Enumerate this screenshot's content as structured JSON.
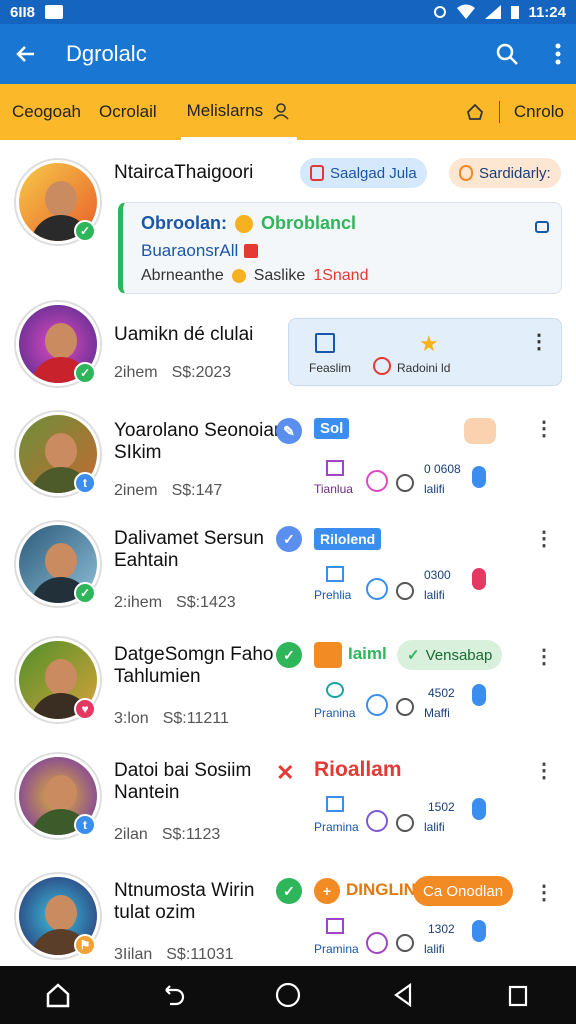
{
  "status_bar": {
    "left_text": "6II8",
    "time": "11:24"
  },
  "app_bar": {
    "title": "Dgrolalc"
  },
  "tabs": {
    "items": [
      {
        "label": "Ceogoah"
      },
      {
        "label": "Ocrolail"
      },
      {
        "label": "Melislarns"
      }
    ],
    "right_label": "Cnrolo"
  },
  "rows": [
    {
      "name": "NtaircaThaigoori",
      "pills": [
        {
          "label": "Saalgad Jula"
        },
        {
          "label": "Sardidarly:"
        }
      ],
      "card": {
        "line1_a": "Obroolan:",
        "line1_b": "Obroblancl",
        "line2": "BuaraonsrAll",
        "line3_a": "Abrneanthe",
        "line3_b": "Saslike",
        "line3_c": "1Snand"
      }
    },
    {
      "name": "Uamikn dé clulai",
      "meta_a": "2ihem",
      "meta_b": "S$:2023",
      "card_labels": {
        "a": "Feaslim",
        "b": "Radoini ld"
      }
    },
    {
      "name": "Yoarolano Seonoian",
      "name2": "SIkim",
      "meta_a": "2inem",
      "meta_b": "S$:147",
      "tag": "Sol",
      "labels": {
        "a": "Tianlua",
        "b": "0 0608",
        "c": "lalifi"
      }
    },
    {
      "name": "Dalivamet Sersun",
      "name2": "Eahtain",
      "meta_a": "2:ihem",
      "meta_b": "S$:1423",
      "tag": "Rilolend",
      "labels": {
        "a": "Prehlia",
        "b": "0300",
        "c": "lalifi"
      }
    },
    {
      "name": "DatgeSomgn Faho",
      "name2": "Tahlumien",
      "meta_a": "3:lon",
      "meta_b": "S$:11211",
      "tag": "Iaiml",
      "pill": "Vensabap",
      "labels": {
        "a": "Pranina",
        "b": "4502",
        "c": "Maffi"
      }
    },
    {
      "name": "Datoi bai Sosiim",
      "name2": "Nantein",
      "meta_a": "2ilan",
      "meta_b": "S$:1123",
      "tag": "Rioallam",
      "labels": {
        "a": "Pramina",
        "b": "1502",
        "c": "lalifi"
      }
    },
    {
      "name": "Ntnumosta Wirin",
      "name2": "tulat ozim",
      "meta_a": "3Iilan",
      "meta_b": "S$:11031",
      "tag": "DINGLIN",
      "pill": "Ca Onodlan",
      "labels": {
        "a": "Pramina",
        "b": "1302",
        "c": "lalifi"
      }
    }
  ],
  "colors": {
    "app_bar": "#1976d2",
    "status_bar": "#1565c0",
    "tabs": "#fbb829",
    "green": "#2fb55a",
    "blue": "#3b8ef0",
    "orange": "#f28b24",
    "red": "#e53935"
  }
}
